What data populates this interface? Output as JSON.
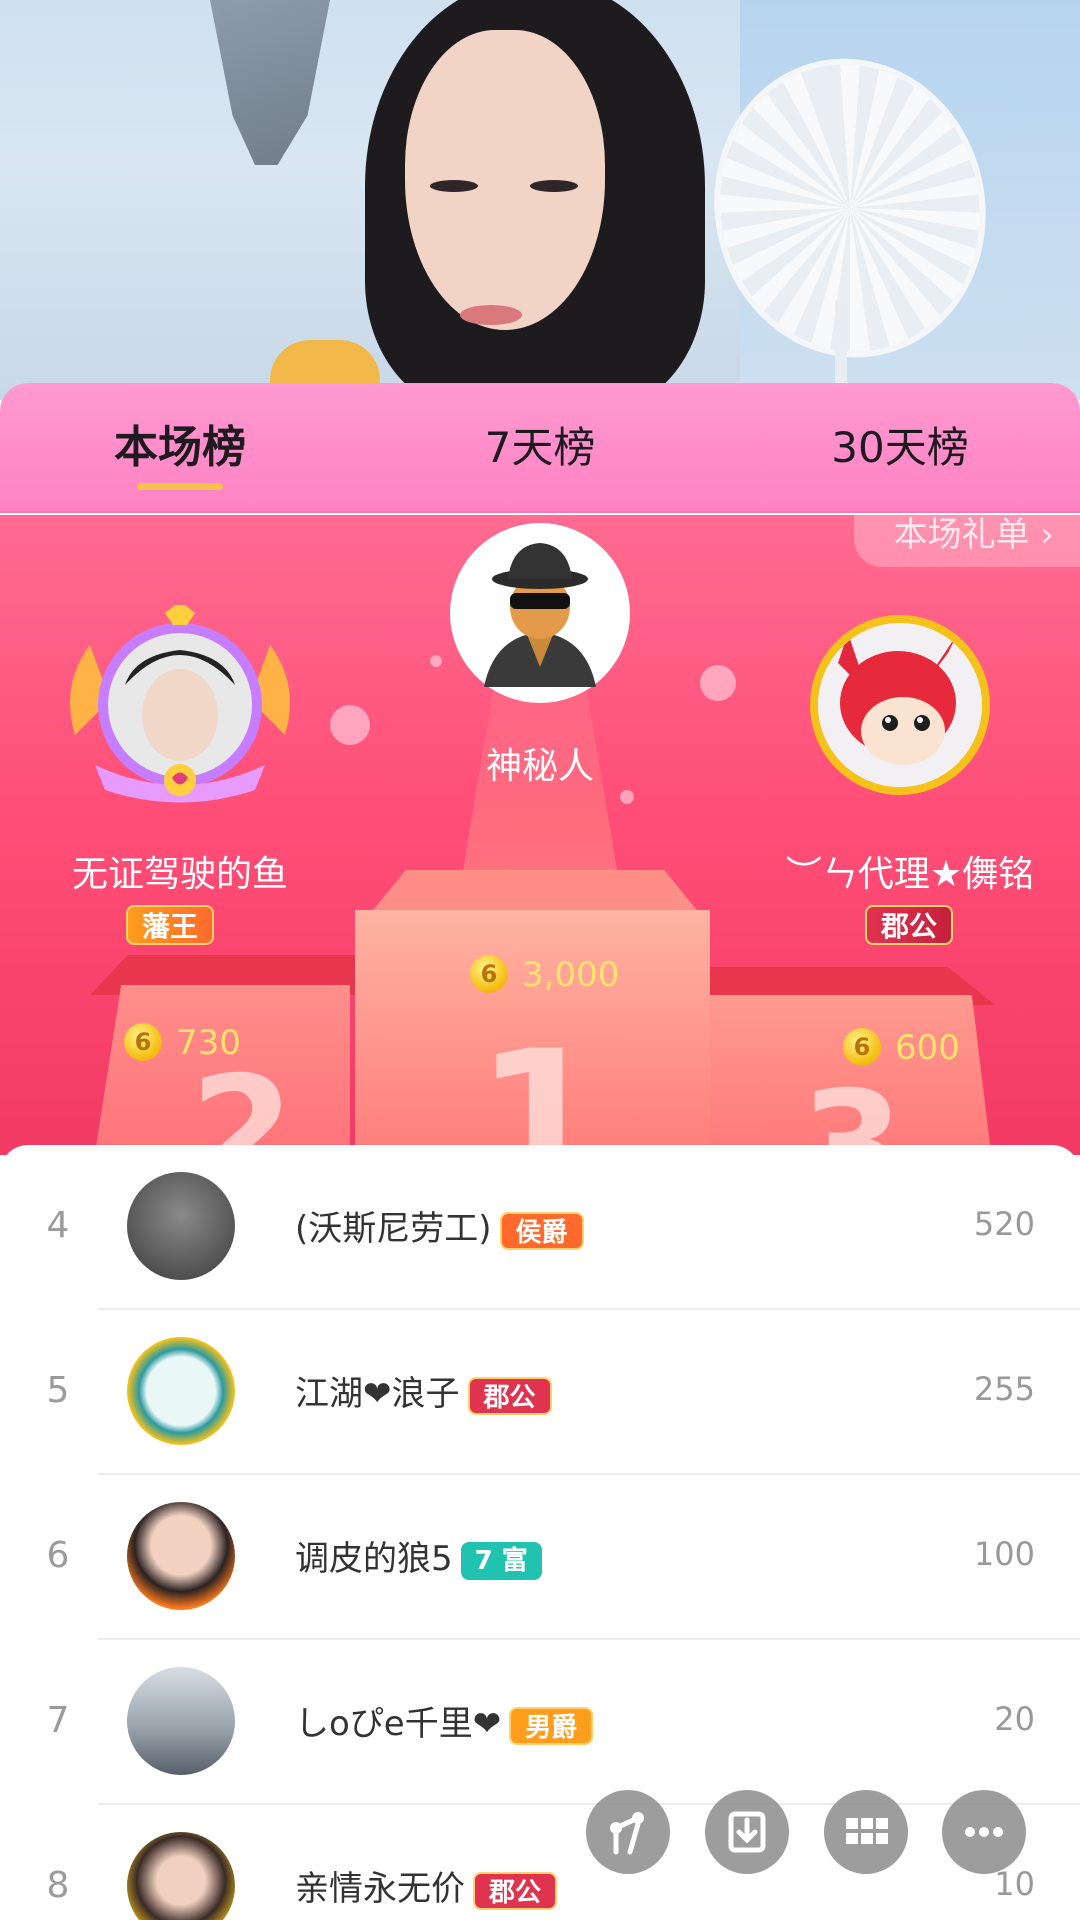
{
  "tabs": [
    {
      "label": "本场榜",
      "active": true
    },
    {
      "label": "7天榜",
      "active": false
    },
    {
      "label": "30天榜",
      "active": false
    }
  ],
  "gift_list_button": "本场礼单 ›",
  "top3": {
    "first": {
      "rank": "1",
      "name": "神秘人",
      "coins": "3,000",
      "avatar": "mystery-man-icon"
    },
    "second": {
      "rank": "2",
      "name": "无证驾驶的鱼",
      "badge": "藩王",
      "coins": "730"
    },
    "third": {
      "rank": "3",
      "name": "︶ㄣ代理★儛铭",
      "badge": "郡公",
      "coins": "600"
    }
  },
  "coin_symbol": "6",
  "list": [
    {
      "rank": "4",
      "name": "(沃斯尼劳工)",
      "badge": "侯爵",
      "badge_color": "#ff6a2c",
      "score": "520"
    },
    {
      "rank": "5",
      "name": "江湖❤浪子",
      "badge": "郡公",
      "badge_color": "#e0334f",
      "score": "255"
    },
    {
      "rank": "6",
      "name": "调皮的狼5",
      "badge": "7 富",
      "badge_color": "#21c3b0",
      "score": "100"
    },
    {
      "rank": "7",
      "name": "しoぴe千里❤",
      "badge": "男爵",
      "badge_color": "#ff9d1d",
      "score": "20"
    },
    {
      "rank": "8",
      "name": "亲情永无价",
      "badge": "郡公",
      "badge_color": "#e0334f",
      "score": "10"
    }
  ],
  "fabs": [
    "share-icon",
    "download-icon",
    "grid-icon",
    "more-icon"
  ],
  "colors": {
    "tab_bar": "#ff8ac8",
    "stage": "#ff4f78",
    "underline": "#f6c24a",
    "coin": "#f5c21b"
  }
}
